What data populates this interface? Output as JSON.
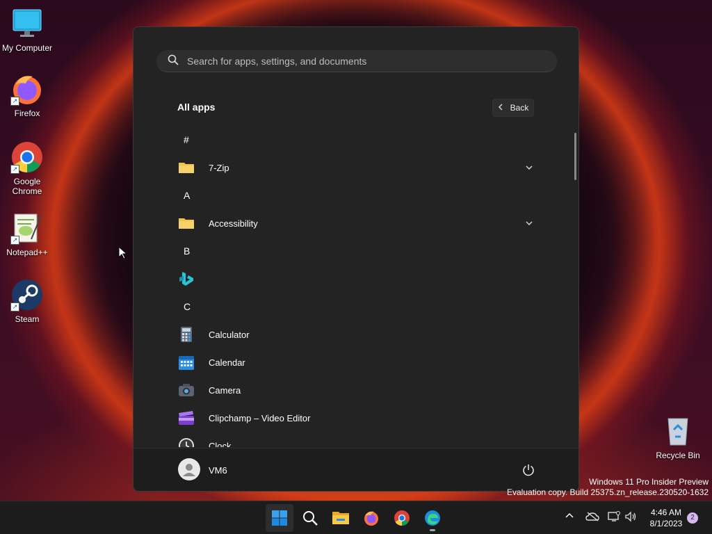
{
  "desktop": {
    "icons": [
      {
        "label": "My Computer"
      },
      {
        "label": "Firefox"
      },
      {
        "label": "Google Chrome"
      },
      {
        "label": "Notepad++"
      },
      {
        "label": "Steam"
      },
      {
        "label": "Recycle Bin"
      }
    ]
  },
  "start_menu": {
    "search_placeholder": "Search for apps, settings, and documents",
    "title": "All apps",
    "back_label": "Back",
    "groups": [
      {
        "letter": "#"
      },
      {
        "letter": "A"
      },
      {
        "letter": "B"
      },
      {
        "letter": "C"
      }
    ],
    "apps": [
      {
        "label": "7-Zip",
        "icon": "folder-icon",
        "expandable": true
      },
      {
        "label": "Accessibility",
        "icon": "folder-icon",
        "expandable": true
      },
      {
        "label": "",
        "icon": "bing-icon",
        "expandable": false
      },
      {
        "label": "Calculator",
        "icon": "calculator-icon",
        "expandable": false
      },
      {
        "label": "Calendar",
        "icon": "calendar-icon",
        "expandable": false
      },
      {
        "label": "Camera",
        "icon": "camera-icon",
        "expandable": false
      },
      {
        "label": "Clipchamp – Video Editor",
        "icon": "clipchamp-icon",
        "expandable": false
      },
      {
        "label": "Clock",
        "icon": "clock-icon",
        "expandable": false
      }
    ],
    "user": {
      "name": "VM6"
    }
  },
  "watermark": {
    "line1": "Windows 11 Pro Insider Preview",
    "line2": "Evaluation copy. Build 25375.zn_release.230520-1632"
  },
  "taskbar": {
    "time": "4:46 AM",
    "date": "8/1/2023",
    "notification_count": "2"
  },
  "colors": {
    "accent": "#0078d4",
    "folder": "#f3c34a",
    "menu_bg": "#232323"
  }
}
